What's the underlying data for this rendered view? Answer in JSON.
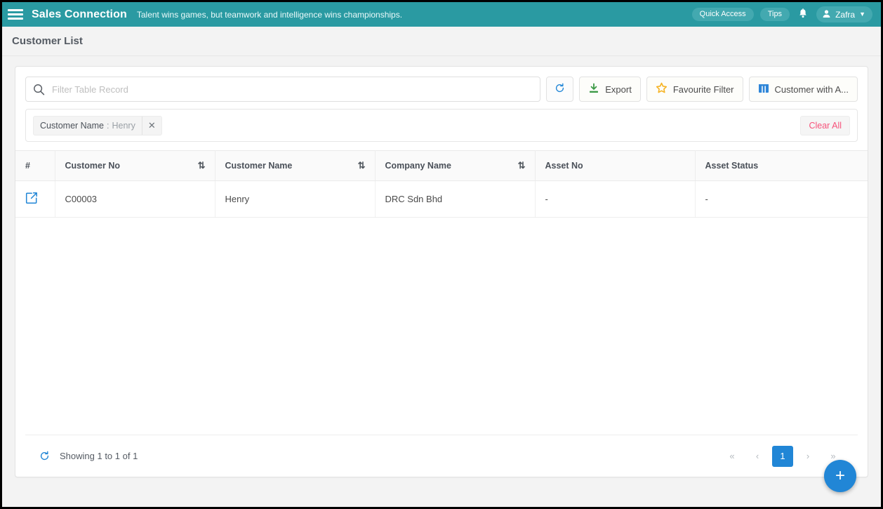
{
  "navbar": {
    "menu_icon": "hamburger-icon",
    "brand": "Sales Connection",
    "tagline": "Talent wins games, but teamwork and intelligence wins championships.",
    "quick_access_label": "Quick Access",
    "tips_label": "Tips",
    "bell_icon": "bell-icon",
    "user_name": "Zafra",
    "user_icon": "user-avatar-icon",
    "caret_icon": "chevron-down-icon",
    "bg_color": "#2a9aa2",
    "pill_color": "#43a9b0"
  },
  "page": {
    "title": "Customer List"
  },
  "toolbar": {
    "search_placeholder": "Filter Table Record",
    "search_value": "",
    "search_icon": "search-icon",
    "refresh_icon": "refresh-icon",
    "export_label": "Export",
    "export_icon": "download-icon",
    "favourite_filter_label": "Favourite Filter",
    "favourite_filter_icon": "star-icon",
    "columns_label": "Customer with A...",
    "columns_icon": "columns-icon"
  },
  "filters": {
    "chips": [
      {
        "key": "Customer Name",
        "separator": ":",
        "value": "Henry",
        "remove_icon": "close-icon"
      }
    ],
    "clear_all_label": "Clear All",
    "clear_all_color": "#f6527a"
  },
  "table": {
    "columns": [
      {
        "label": "#",
        "sortable": false,
        "sort_icon": ""
      },
      {
        "label": "Customer No",
        "sortable": true,
        "sort_icon": "sort-icon"
      },
      {
        "label": "Customer Name",
        "sortable": true,
        "sort_icon": "sort-icon"
      },
      {
        "label": "Company Name",
        "sortable": true,
        "sort_icon": "sort-icon"
      },
      {
        "label": "Asset No",
        "sortable": false,
        "sort_icon": ""
      },
      {
        "label": "Asset Status",
        "sortable": false,
        "sort_icon": ""
      }
    ],
    "rows": [
      {
        "open_icon": "external-link-icon",
        "customer_no": "C00003",
        "customer_name": "Henry",
        "company_name": "DRC Sdn Bhd",
        "asset_no": "-",
        "asset_status": "-"
      }
    ]
  },
  "footer": {
    "refresh_icon": "refresh-icon",
    "showing_text": "Showing 1 to 1 of 1",
    "pager": {
      "first_label": "«",
      "prev_label": "‹",
      "pages": [
        "1"
      ],
      "active_page": "1",
      "next_label": "›",
      "last_label": "»"
    }
  },
  "fab": {
    "label": "+",
    "icon": "plus-icon",
    "color": "#2186d6"
  }
}
